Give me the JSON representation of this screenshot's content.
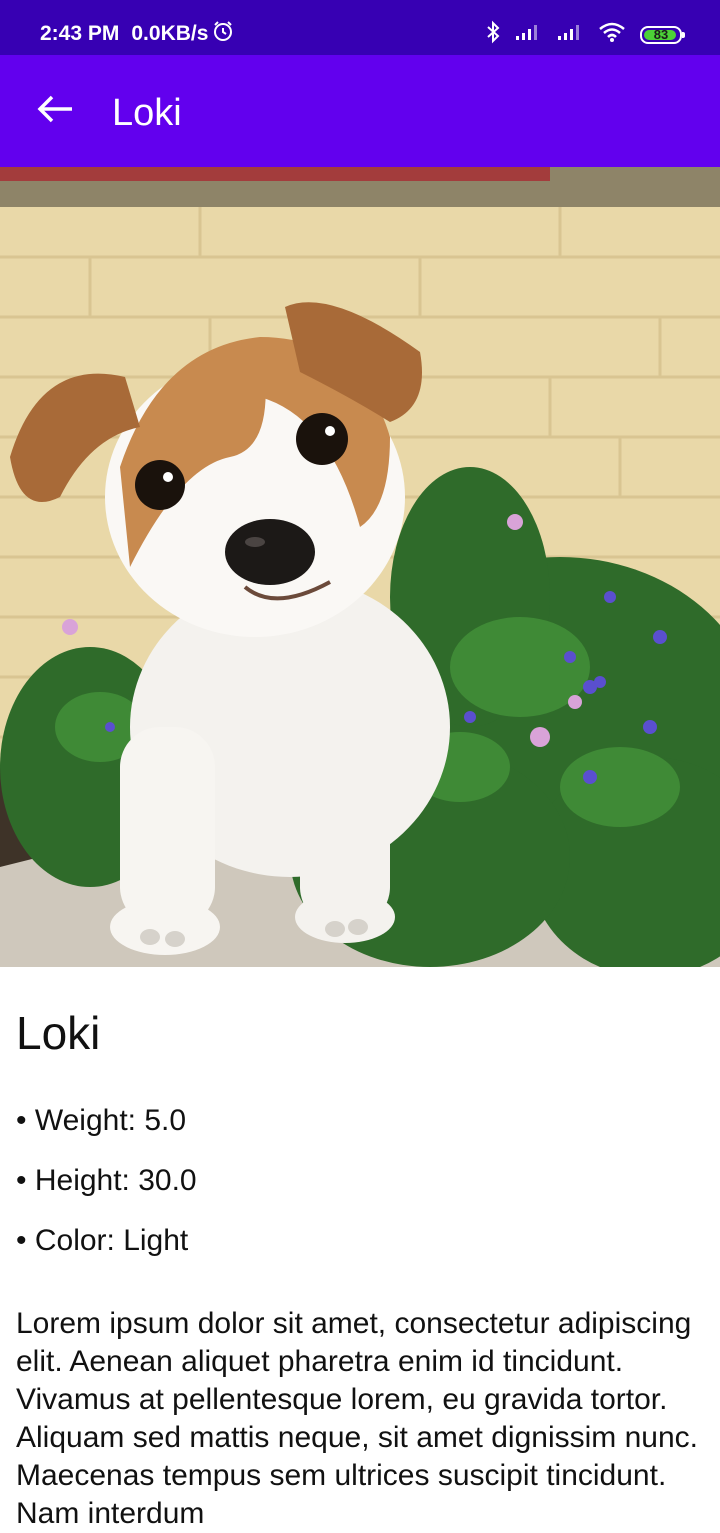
{
  "status_bar": {
    "time": "2:43 PM",
    "speed": "0.0KB/s",
    "battery_level": "83",
    "icons": [
      "alarm-icon",
      "bluetooth-icon",
      "signal-icon",
      "signal-icon",
      "wifi-icon",
      "battery-icon"
    ]
  },
  "app_bar": {
    "title": "Loki",
    "color": "#6200ee",
    "status_color": "#3700b3"
  },
  "dog": {
    "name": "Loki",
    "weight": "• Weight: 5.0",
    "height": "• Height: 30.0",
    "color": "• Color: Light",
    "description": "Lorem ipsum dolor sit amet, consectetur adipiscing elit. Aenean aliquet pharetra enim id tincidunt. Vivamus at pellentesque lorem, eu gravida tortor. Aliquam sed mattis neque, sit amet dignissim nunc. Maecenas tempus sem ultrices suscipit tincidunt. Nam interdum"
  }
}
